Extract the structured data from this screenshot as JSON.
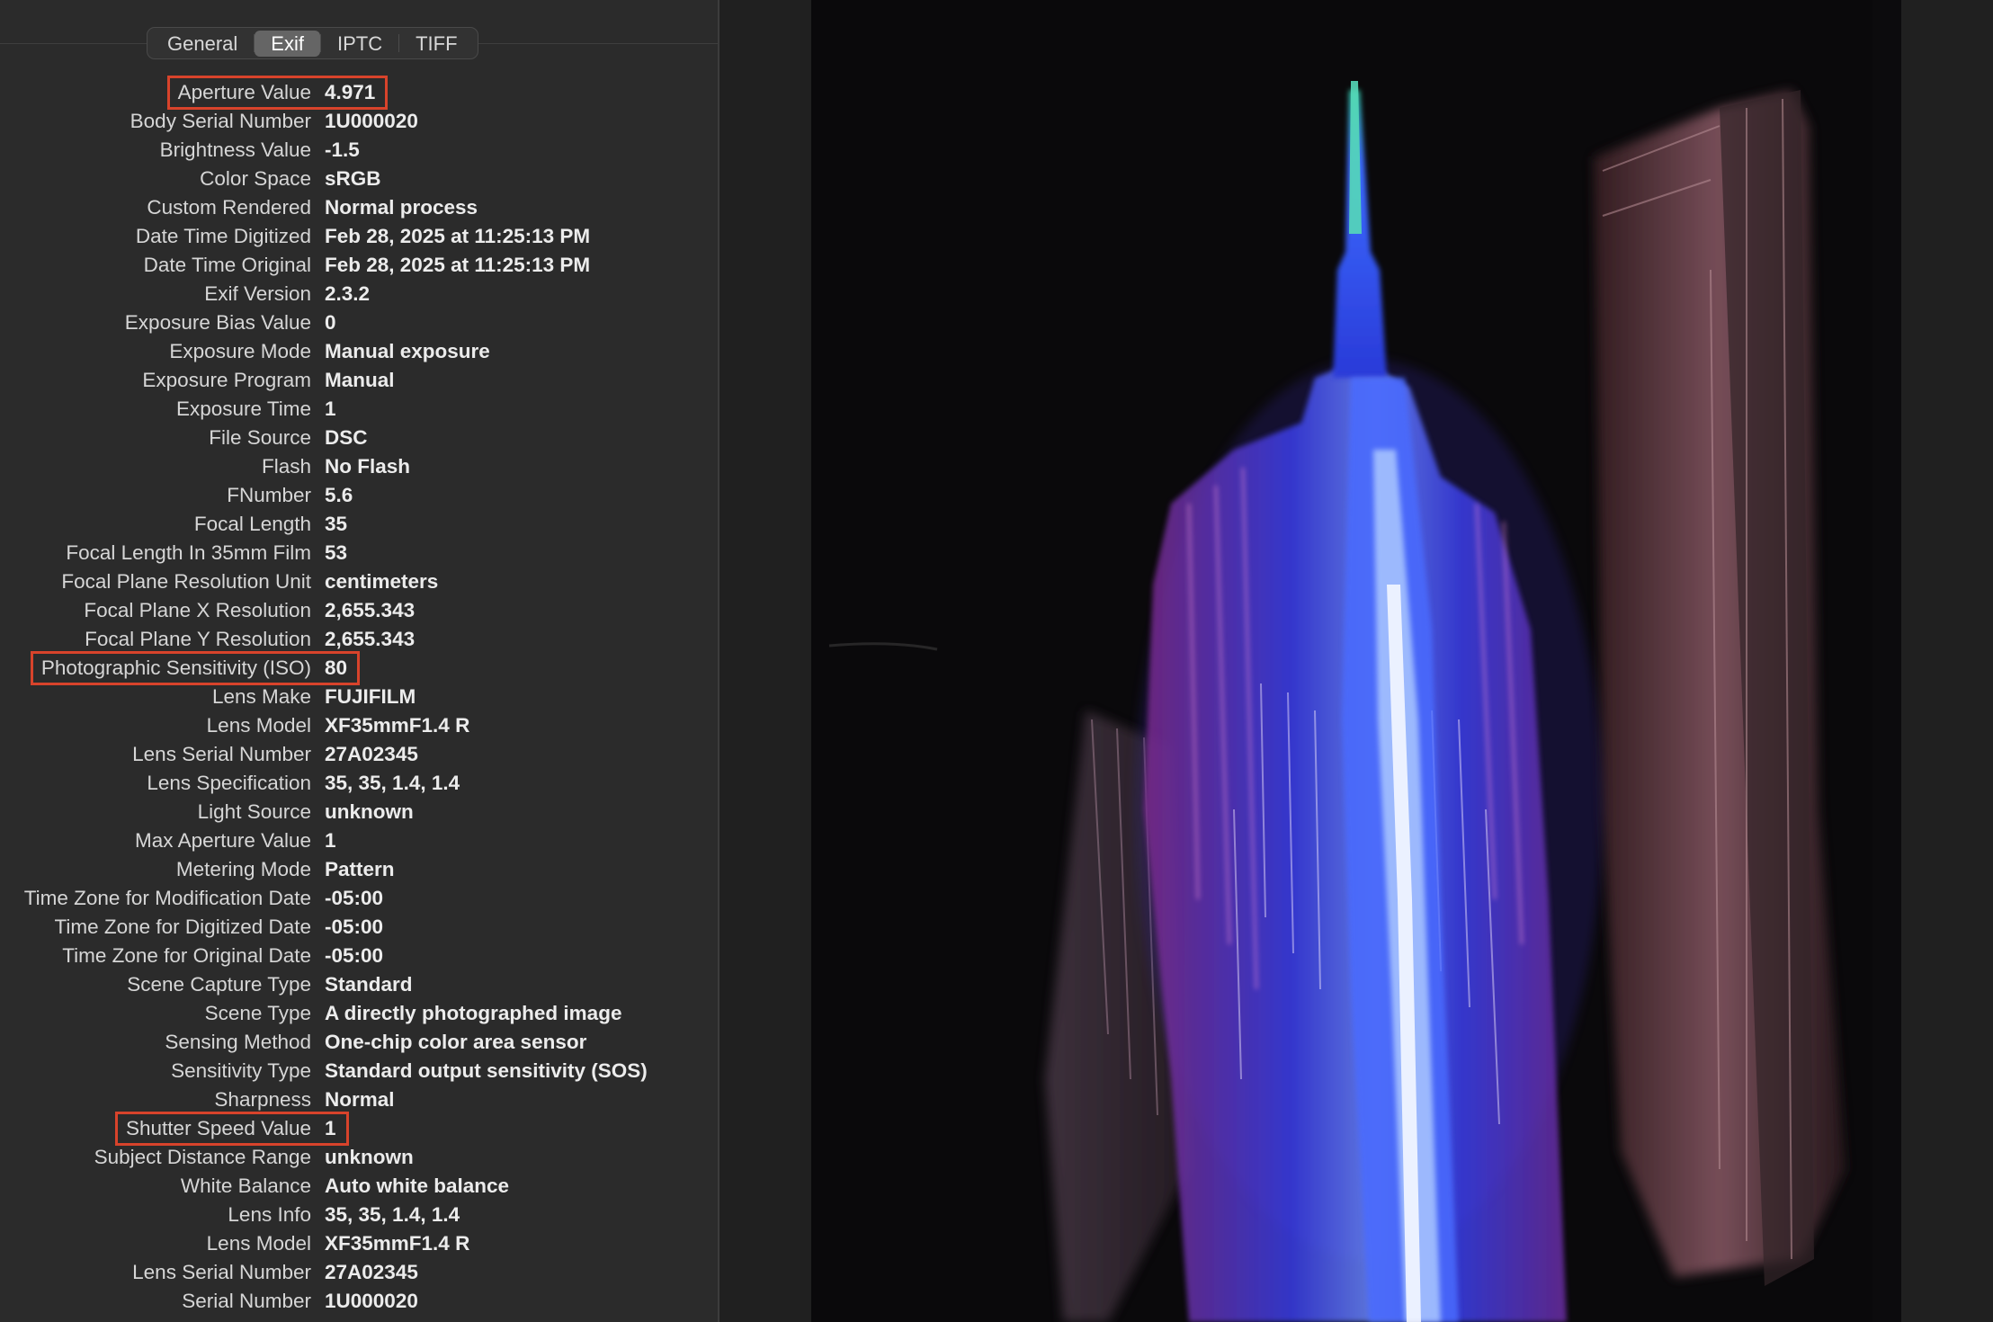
{
  "tabs": [
    {
      "label": "General",
      "active": false
    },
    {
      "label": "Exif",
      "active": true
    },
    {
      "label": "IPTC",
      "active": false
    },
    {
      "label": "TIFF",
      "active": false
    }
  ],
  "exif_rows": [
    {
      "label": "Aperture Value",
      "value": "4.971",
      "highlighted": true
    },
    {
      "label": "Body Serial Number",
      "value": "1U000020"
    },
    {
      "label": "Brightness Value",
      "value": "-1.5"
    },
    {
      "label": "Color Space",
      "value": "sRGB"
    },
    {
      "label": "Custom Rendered",
      "value": "Normal process"
    },
    {
      "label": "Date Time Digitized",
      "value": "Feb 28, 2025 at 11:25:13 PM"
    },
    {
      "label": "Date Time Original",
      "value": "Feb 28, 2025 at 11:25:13 PM"
    },
    {
      "label": "Exif Version",
      "value": "2.3.2"
    },
    {
      "label": "Exposure Bias Value",
      "value": "0"
    },
    {
      "label": "Exposure Mode",
      "value": "Manual exposure"
    },
    {
      "label": "Exposure Program",
      "value": "Manual"
    },
    {
      "label": "Exposure Time",
      "value": "1"
    },
    {
      "label": "File Source",
      "value": "DSC"
    },
    {
      "label": "Flash",
      "value": "No Flash"
    },
    {
      "label": "FNumber",
      "value": "5.6"
    },
    {
      "label": "Focal Length",
      "value": "35"
    },
    {
      "label": "Focal Length In 35mm Film",
      "value": "53"
    },
    {
      "label": "Focal Plane Resolution Unit",
      "value": "centimeters"
    },
    {
      "label": "Focal Plane X Resolution",
      "value": "2,655.343"
    },
    {
      "label": "Focal Plane Y Resolution",
      "value": "2,655.343"
    },
    {
      "label": "Photographic Sensitivity (ISO)",
      "value": "80",
      "highlighted": true
    },
    {
      "label": "Lens Make",
      "value": "FUJIFILM"
    },
    {
      "label": "Lens Model",
      "value": "XF35mmF1.4 R"
    },
    {
      "label": "Lens Serial Number",
      "value": "27A02345"
    },
    {
      "label": "Lens Specification",
      "value": "35, 35, 1.4, 1.4"
    },
    {
      "label": "Light Source",
      "value": "unknown"
    },
    {
      "label": "Max Aperture Value",
      "value": "1"
    },
    {
      "label": "Metering Mode",
      "value": "Pattern"
    },
    {
      "label": "Time Zone for Modification Date",
      "value": "-05:00"
    },
    {
      "label": "Time Zone for Digitized Date",
      "value": "-05:00"
    },
    {
      "label": "Time Zone for Original Date",
      "value": "-05:00"
    },
    {
      "label": "Scene Capture Type",
      "value": "Standard"
    },
    {
      "label": "Scene Type",
      "value": "A directly photographed image"
    },
    {
      "label": "Sensing Method",
      "value": "One-chip color area sensor"
    },
    {
      "label": "Sensitivity Type",
      "value": "Standard output sensitivity (SOS)"
    },
    {
      "label": "Sharpness",
      "value": "Normal"
    },
    {
      "label": "Shutter Speed Value",
      "value": "1",
      "highlighted": true
    },
    {
      "label": "Subject Distance Range",
      "value": "unknown"
    },
    {
      "label": "White Balance",
      "value": "Auto white balance"
    },
    {
      "label": "Lens Info",
      "value": "35, 35, 1.4, 1.4"
    },
    {
      "label": "Lens Model",
      "value": "XF35mmF1.4 R"
    },
    {
      "label": "Lens Serial Number",
      "value": "27A02345"
    },
    {
      "label": "Serial Number",
      "value": "1U000020"
    }
  ],
  "colors": {
    "panel_bg": "#2b2b2b",
    "highlight_box": "#d8432b",
    "label_text": "#d6d6d6",
    "value_text": "#ececec",
    "tab_active_bg": "#656565"
  },
  "photo": {
    "subject_icon": "long-exposure-skyscraper-photo"
  }
}
